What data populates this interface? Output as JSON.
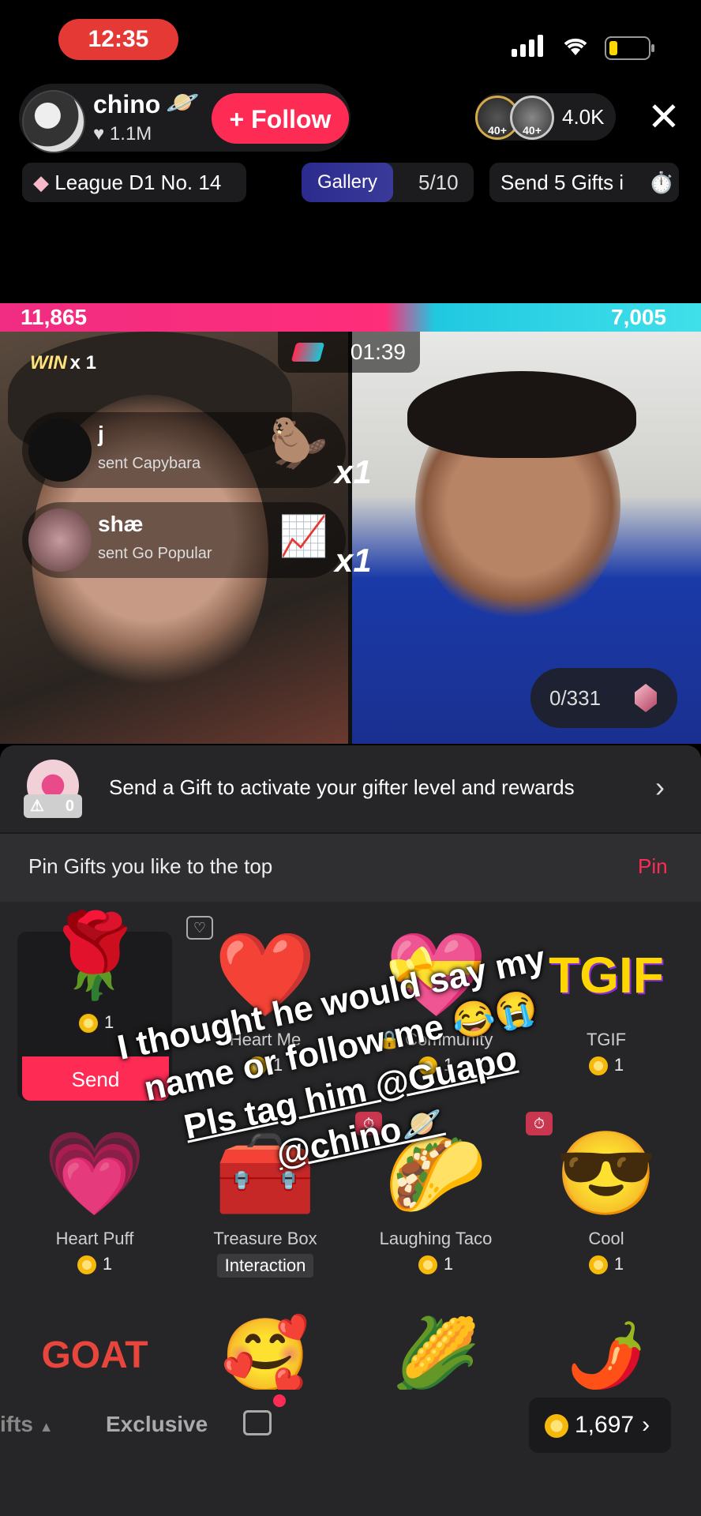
{
  "status": {
    "time": "12:35"
  },
  "host": {
    "name": "chino",
    "likes": "1.1M",
    "follow_label": "+ Follow"
  },
  "viewers": {
    "count": "4.0K",
    "avatar_badges": [
      "40+",
      "40+"
    ]
  },
  "tags": {
    "league": "League D1 No. 14",
    "gallery_label": "Gallery",
    "gallery_count": "5/10",
    "send_gifts": "Send 5 Gifts i"
  },
  "battle": {
    "score_left": "11,865",
    "score_right": "7,005",
    "win_label": "WIN",
    "win_count": "x 1",
    "timer": "01:39",
    "points": "0/331"
  },
  "gift_feed": [
    {
      "user": "j",
      "text": "sent Capybara",
      "multiplier": "x1"
    },
    {
      "user": "shæ",
      "text": "sent Go Popular",
      "multiplier": "x1"
    }
  ],
  "gifter": {
    "badge_value": "0",
    "text": "Send a Gift to activate your gifter level and rewards"
  },
  "pin": {
    "text": "Pin Gifts you like to the top",
    "button": "Pin"
  },
  "gifts_row1": [
    {
      "name": "Rose",
      "price": "1",
      "send_label": "Send"
    },
    {
      "name": "Heart Me",
      "price": "1"
    },
    {
      "name": "Community",
      "price": "1"
    },
    {
      "name": "TGIF",
      "price": "1"
    }
  ],
  "gifts_row2": [
    {
      "name": "Heart Puff",
      "price": "1"
    },
    {
      "name": "Treasure Box",
      "tag": "Interaction"
    },
    {
      "name": "Laughing Taco",
      "price": "1"
    },
    {
      "name": "Cool",
      "price": "1"
    }
  ],
  "caption": {
    "line1": "I thought he would say my",
    "line2": "name or follow me 😂😭",
    "line3": "Pls tag him @Guapo",
    "line4": "@chino🪐"
  },
  "bottom": {
    "tab_gifts": "ifts",
    "tab_exclusive": "Exclusive",
    "coins": "1,697"
  }
}
